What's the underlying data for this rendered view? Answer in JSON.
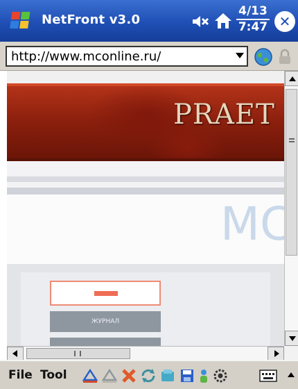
{
  "titlebar": {
    "app_title": "NetFront v3.0",
    "date": "4/13",
    "time": "7:47",
    "close_label": "✕"
  },
  "addressbar": {
    "url": "http://www.mconline.ru/"
  },
  "page": {
    "banner_text": "PRAET",
    "logo_text": "MС",
    "button_text": "ЖУРНАЛ"
  },
  "toolbar": {
    "file_label": "File",
    "tool_label": "Tool"
  },
  "icons": {
    "start": "windows-flag-icon",
    "speaker": "speaker-muted-icon",
    "home": "home-icon",
    "globe": "globe-icon",
    "lock": "lock-icon"
  },
  "colors": {
    "titlebar": "#1f4fb5",
    "banner": "#8a1f0d",
    "chrome": "#d4d0c8"
  }
}
